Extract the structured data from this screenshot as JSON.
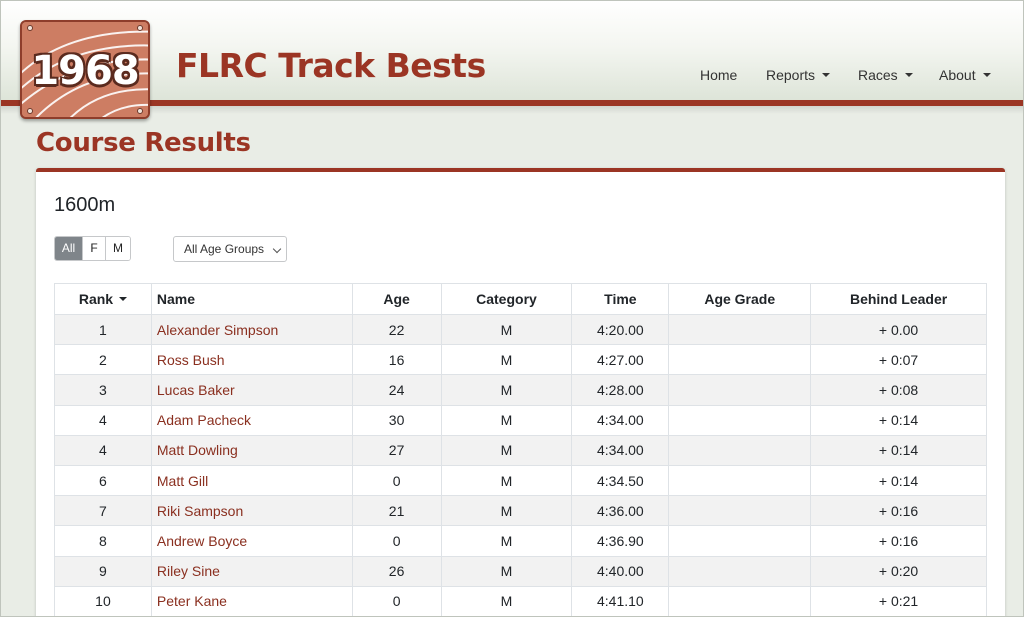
{
  "logo": {
    "text": "1968"
  },
  "site": {
    "title": "FLRC Track Bests"
  },
  "nav": {
    "home": "Home",
    "reports": "Reports",
    "races": "Races",
    "about": "About"
  },
  "page": {
    "title": "Course Results"
  },
  "course": {
    "name": "1600m"
  },
  "filters": {
    "sex_options": [
      "All",
      "F",
      "M"
    ],
    "sex_selected": "All",
    "age_group_selected": "All Age Groups"
  },
  "table": {
    "columns": [
      "Rank",
      "Name",
      "Age",
      "Category",
      "Time",
      "Age Grade",
      "Behind Leader"
    ],
    "sorted_by": "Rank",
    "rows": [
      {
        "rank": "1",
        "name": "Alexander Simpson",
        "age": "22",
        "category": "M",
        "time": "4:20.00",
        "age_grade": "",
        "behind": "+ 0.00"
      },
      {
        "rank": "2",
        "name": "Ross Bush",
        "age": "16",
        "category": "M",
        "time": "4:27.00",
        "age_grade": "",
        "behind": "+ 0:07"
      },
      {
        "rank": "3",
        "name": "Lucas Baker",
        "age": "24",
        "category": "M",
        "time": "4:28.00",
        "age_grade": "",
        "behind": "+ 0:08"
      },
      {
        "rank": "4",
        "name": "Adam Pacheck",
        "age": "30",
        "category": "M",
        "time": "4:34.00",
        "age_grade": "",
        "behind": "+ 0:14"
      },
      {
        "rank": "4",
        "name": "Matt Dowling",
        "age": "27",
        "category": "M",
        "time": "4:34.00",
        "age_grade": "",
        "behind": "+ 0:14"
      },
      {
        "rank": "6",
        "name": "Matt Gill",
        "age": "0",
        "category": "M",
        "time": "4:34.50",
        "age_grade": "",
        "behind": "+ 0:14"
      },
      {
        "rank": "7",
        "name": "Riki Sampson",
        "age": "21",
        "category": "M",
        "time": "4:36.00",
        "age_grade": "",
        "behind": "+ 0:16"
      },
      {
        "rank": "8",
        "name": "Andrew Boyce",
        "age": "0",
        "category": "M",
        "time": "4:36.90",
        "age_grade": "",
        "behind": "+ 0:16"
      },
      {
        "rank": "9",
        "name": "Riley Sine",
        "age": "26",
        "category": "M",
        "time": "4:40.00",
        "age_grade": "",
        "behind": "+ 0:20"
      },
      {
        "rank": "10",
        "name": "Peter Kane",
        "age": "0",
        "category": "M",
        "time": "4:41.10",
        "age_grade": "",
        "behind": "+ 0:21"
      }
    ]
  },
  "colors": {
    "brand": "#9b3524",
    "link": "#8a2f1f",
    "active_toggle": "#7f858a"
  }
}
